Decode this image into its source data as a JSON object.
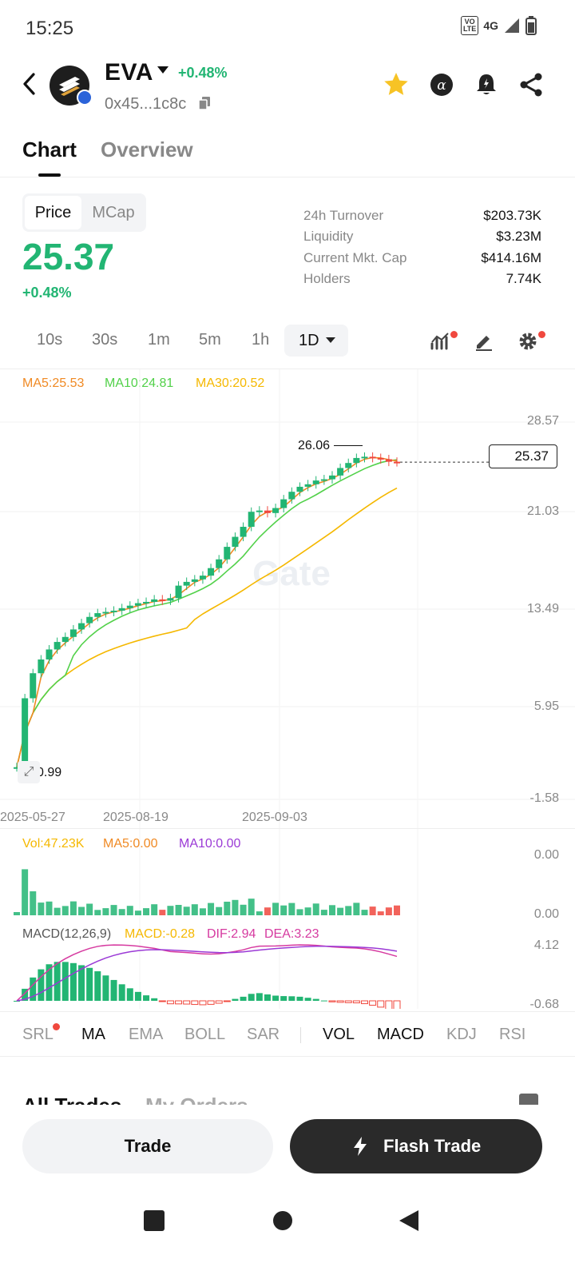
{
  "status": {
    "time": "15:25",
    "volte_top": "VO",
    "volte_bottom": "LTE",
    "network": "4G"
  },
  "header": {
    "symbol": "EVA",
    "change": "+0.48%",
    "address": "0x45...1c8c"
  },
  "tabs": [
    {
      "label": "Chart"
    },
    {
      "label": "Overview"
    }
  ],
  "price_toggle": {
    "active": "Price",
    "inactive": "MCap"
  },
  "price": {
    "value": "25.37",
    "change": "+0.48%"
  },
  "stats": [
    {
      "label": "24h Turnover",
      "value": "$203.73K"
    },
    {
      "label": "Liquidity",
      "value": "$3.23M"
    },
    {
      "label": "Current Mkt. Cap",
      "value": "$414.16M"
    },
    {
      "label": "Holders",
      "value": "7.74K"
    }
  ],
  "intervals": [
    "10s",
    "30s",
    "1m",
    "5m",
    "1h"
  ],
  "interval_active": "1D",
  "ma_legend": {
    "ma5": "MA5:25.53",
    "ma10": "MA10:24.81",
    "ma30": "MA30:20.52"
  },
  "colors": {
    "up": "#22b573",
    "down": "#f0483e",
    "ma5": "#f08a24",
    "ma10": "#52d14a",
    "ma30": "#f5b800",
    "macd_dif": "#d63aa0",
    "macd_dea": "#9b3ad6"
  },
  "chart_data": {
    "type": "candlestick",
    "y_ticks": [
      "28.57",
      "21.03",
      "13.49",
      "5.95",
      "-1.58"
    ],
    "x_ticks": [
      "2025-05-27",
      "2025-08-19",
      "2025-09-03"
    ],
    "high_label": "26.06",
    "low_label": "0.99",
    "current_price_label": "25.37",
    "ylim": [
      -1.58,
      28.57
    ],
    "close": [
      0.99,
      6.5,
      8.5,
      9.6,
      10.4,
      11.0,
      11.4,
      12.0,
      12.5,
      13.0,
      13.3,
      13.4,
      13.5,
      13.7,
      13.9,
      14.1,
      14.2,
      14.4,
      14.3,
      14.5,
      15.5,
      15.8,
      16.0,
      16.3,
      16.9,
      17.6,
      18.6,
      19.4,
      20.2,
      21.4,
      21.5,
      21.3,
      21.7,
      22.4,
      23.0,
      23.4,
      23.6,
      23.9,
      24.0,
      24.3,
      24.9,
      25.3,
      25.7,
      25.8,
      25.7,
      25.6,
      25.4,
      25.37
    ]
  },
  "volume_legend": {
    "vol": "Vol:47.23K",
    "ma5": "MA5:0.00",
    "ma10": "MA10:0.00"
  },
  "volume_axis": [
    "0.00",
    "0.00"
  ],
  "macd_legend": {
    "params": "MACD(12,26,9)",
    "macd": "MACD:-0.28",
    "dif": "DIF:2.94",
    "dea": "DEA:3.23"
  },
  "macd_axis": [
    "4.12",
    "-0.68"
  ],
  "indicator_tabs": [
    "SRL",
    "MA",
    "EMA",
    "BOLL",
    "SAR",
    "VOL",
    "MACD",
    "KDJ",
    "RSI"
  ],
  "section_tabs": [
    "All Trades",
    "My Orders"
  ],
  "buttons": {
    "trade": "Trade",
    "flash": "Flash Trade"
  }
}
